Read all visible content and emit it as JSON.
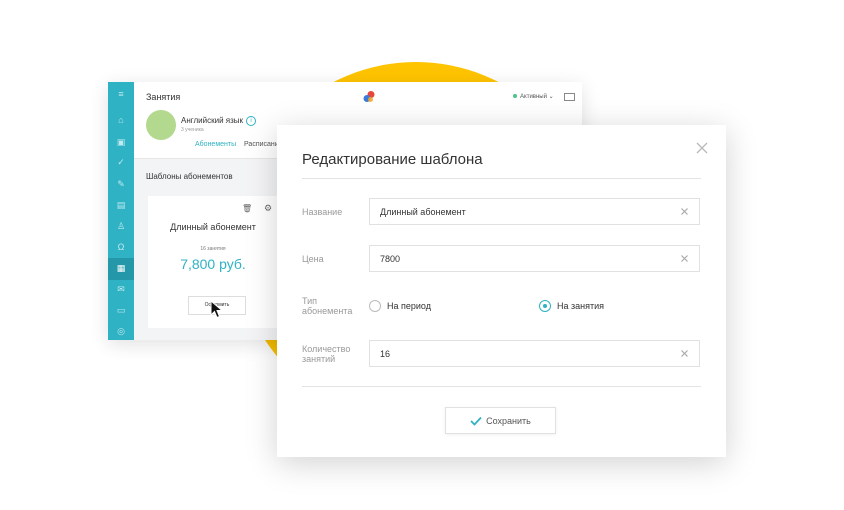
{
  "background_window": {
    "section_title": "Занятия",
    "status": "Активный",
    "course": {
      "name": "Английский язык",
      "students": "3 ученика"
    },
    "tabs": [
      "Абонементы",
      "Расписание"
    ],
    "templates_title": "Шаблоны абонементов",
    "card": {
      "name": "Длинный абонемент",
      "lessons": "16 занятия",
      "price": "7,800 руб.",
      "button": "Оформить"
    }
  },
  "modal": {
    "title": "Редактирование шаблона",
    "fields": {
      "name": {
        "label": "Название",
        "value": "Длинный абонемент"
      },
      "price": {
        "label": "Цена",
        "value": "7800"
      },
      "type": {
        "label_line1": "Тип",
        "label_line2": "абонемента",
        "options": [
          "На период",
          "На занятия"
        ],
        "selected": "На занятия"
      },
      "count": {
        "label_line1": "Количество",
        "label_line2": "занятий",
        "value": "16"
      }
    },
    "save_label": "Сохранить"
  },
  "colors": {
    "accent": "#2FB2C3",
    "yellow_circle": "#FFC400",
    "avatar": "#b3d98e"
  }
}
